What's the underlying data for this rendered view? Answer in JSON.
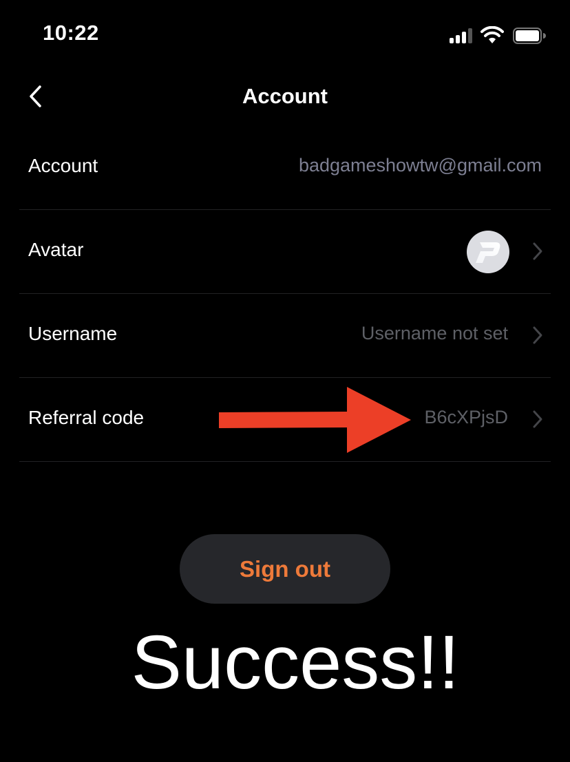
{
  "status_bar": {
    "time": "10:22",
    "icons": [
      "cellular-signal-icon",
      "wifi-icon",
      "battery-icon"
    ]
  },
  "nav": {
    "back_icon": "chevron-left-icon",
    "title": "Account"
  },
  "rows": [
    {
      "label": "Account",
      "value": "badgameshowtw@gmail.com",
      "has_chevron": false
    },
    {
      "label": "Avatar",
      "value": "",
      "avatar_icon": "app-logo-p-icon",
      "has_chevron": true
    },
    {
      "label": "Username",
      "value": "Username not set",
      "has_chevron": true
    },
    {
      "label": "Referral code",
      "value": "B6cXPjsD",
      "has_chevron": true
    }
  ],
  "annotation": {
    "arrow_color": "#ec3f27",
    "arrow_icon": "red-arrow-right-icon",
    "text": "Success!!"
  },
  "buttons": {
    "sign_out": "Sign out"
  },
  "colors": {
    "background": "#000000",
    "accent_orange": "#ee7a3a",
    "button_bg": "#26272b",
    "value_text": "#7d7f92",
    "muted_text": "#5e6066",
    "divider": "#222224"
  }
}
